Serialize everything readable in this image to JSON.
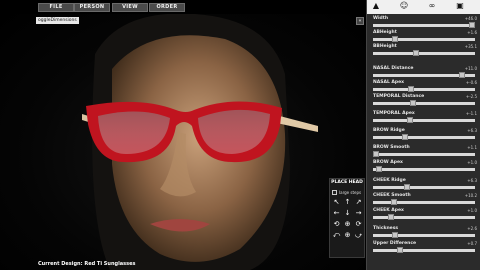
{
  "menu": [
    {
      "label": "FILE"
    },
    {
      "label": "PERSON"
    },
    {
      "label": "VIEW"
    },
    {
      "label": "ORDER"
    }
  ],
  "viewport": {
    "toggle_chip": "oggleDimensions",
    "collapse_icon": "«",
    "status": "Current Design: Red Ti Sunglasses"
  },
  "place_head": {
    "title": "PLACE HEAD",
    "large_steps_label": "large steps",
    "buttons": [
      "↖",
      "↑",
      "↗",
      "←",
      "↓",
      "→",
      "⟲",
      "⊕",
      "⟳",
      "⤺",
      "⊕",
      "⤻"
    ]
  },
  "side_icons": [
    "hat-icon",
    "face-icon",
    "glasses-icon",
    "frame-icon"
  ],
  "params": [
    {
      "label": "Width",
      "value": "+46.0",
      "level": 0.97
    },
    {
      "label": "ABHeight",
      "value": "+1.6",
      "level": 0.22
    },
    {
      "label": "BBHeight",
      "value": "+35.1",
      "level": 0.42
    },
    {
      "label": "NASAL Distance",
      "value": "+11.0",
      "level": 0.87
    },
    {
      "label": "NASAL Apex",
      "value": "+-0.6",
      "level": 0.37
    },
    {
      "label": "TEMPORAL Distance",
      "value": "+-2.5",
      "level": 0.39
    },
    {
      "label": "TEMPORAL Apex",
      "value": "+-1.1",
      "level": 0.36
    },
    {
      "label": "BROW Ridge",
      "value": "+6.3",
      "level": 0.31
    },
    {
      "label": "BROW Smooth",
      "value": "+1.1",
      "level": 0.03
    },
    {
      "label": "BROW Apex",
      "value": "+1.0",
      "level": 0.06
    },
    {
      "label": "CHEEK Ridge",
      "value": "+6.3",
      "level": 0.33
    },
    {
      "label": "CHEEK Smooth",
      "value": "+10.2",
      "level": 0.21
    },
    {
      "label": "CHEEK Apex",
      "value": "+1.0",
      "level": 0.18
    },
    {
      "label": "Thickness",
      "value": "+2.6",
      "level": 0.22
    },
    {
      "label": "Upper Difference",
      "value": "+0.7",
      "level": 0.26
    }
  ]
}
